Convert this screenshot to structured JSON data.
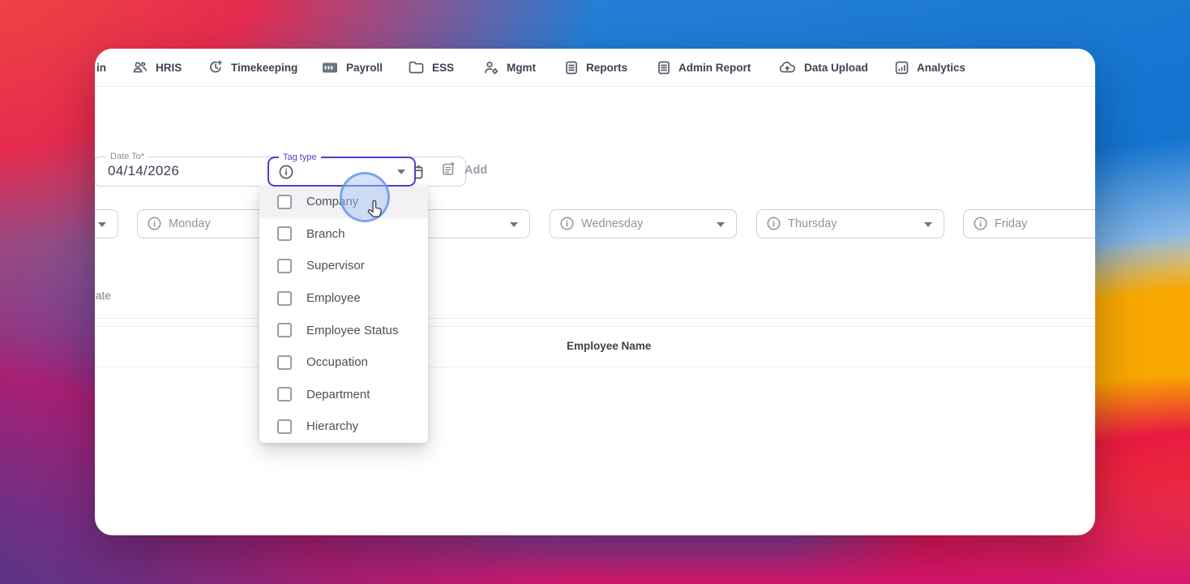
{
  "colors": {
    "accent_purple": "#5140c8",
    "nav_text": "#3c4350",
    "field_border": "#ccd1d8",
    "muted_text": "#8f949d",
    "highlight_row": "#f2f2f4",
    "click_ring_blue": "#6096e8"
  },
  "nav": {
    "items": [
      {
        "label": "in"
      },
      {
        "label": "HRIS"
      },
      {
        "label": "Timekeeping"
      },
      {
        "label": "Payroll"
      },
      {
        "label": "ESS"
      },
      {
        "label": "Mgmt"
      },
      {
        "label": "Reports"
      },
      {
        "label": "Admin Report"
      },
      {
        "label": "Data Upload"
      },
      {
        "label": "Analytics"
      }
    ]
  },
  "filters": {
    "date_to": {
      "label": "Date To*",
      "value": "04/14/2026"
    },
    "tag_type": {
      "label": "Tag type",
      "value": ""
    },
    "add_button": {
      "label": "Add"
    }
  },
  "day_fields": [
    {
      "label": ""
    },
    {
      "label": "Monday"
    },
    {
      "label": ""
    },
    {
      "label": "Wednesday"
    },
    {
      "label": "Thursday"
    },
    {
      "label": "Friday"
    }
  ],
  "tag_dropdown": {
    "options": [
      {
        "label": "Company",
        "checked": false,
        "hovered": true
      },
      {
        "label": "Branch",
        "checked": false,
        "hovered": false
      },
      {
        "label": "Supervisor",
        "checked": false,
        "hovered": false
      },
      {
        "label": "Employee",
        "checked": false,
        "hovered": false
      },
      {
        "label": "Employee Status",
        "checked": false,
        "hovered": false
      },
      {
        "label": "Occupation",
        "checked": false,
        "hovered": false
      },
      {
        "label": "Department",
        "checked": false,
        "hovered": false
      },
      {
        "label": "Hierarchy",
        "checked": false,
        "hovered": false
      }
    ]
  },
  "table": {
    "partial_left_text": "ate",
    "header": "Employee Name"
  }
}
